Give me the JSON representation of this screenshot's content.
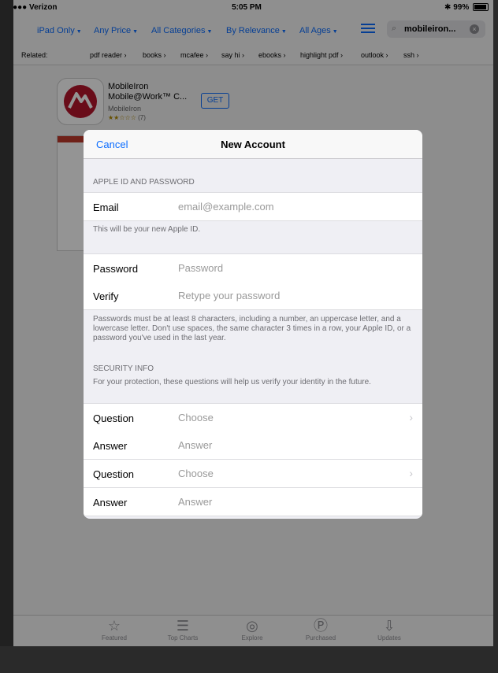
{
  "status": {
    "carrier": "●●●●● Verizon",
    "time": "5:05 PM",
    "battery": "99%"
  },
  "filters": {
    "device": "iPad Only",
    "price": "Any Price",
    "categories": "All Categories",
    "sort": "By Relevance",
    "ages": "All Ages"
  },
  "search": {
    "query": "mobileiron..."
  },
  "related": {
    "label": "Related:",
    "items": [
      "pdf reader",
      "books",
      "mcafee",
      "say hi",
      "ebooks",
      "highlight pdf",
      "outlook",
      "ssh"
    ]
  },
  "app": {
    "name_line1": "MobileIron",
    "name_line2": "Mobile@Work™ C...",
    "developer": "MobileIron",
    "stars": "★★☆☆☆",
    "rating_count": "(7)",
    "get_label": "GET"
  },
  "tabs": [
    {
      "label": "Featured",
      "icon": "star-icon"
    },
    {
      "label": "Top Charts",
      "icon": "list-icon"
    },
    {
      "label": "Explore",
      "icon": "compass-icon"
    },
    {
      "label": "Purchased",
      "icon": "purchased-icon"
    },
    {
      "label": "Updates",
      "icon": "download-icon"
    }
  ],
  "modal": {
    "cancel": "Cancel",
    "title": "New Account",
    "apple_id_header": "APPLE ID AND PASSWORD",
    "email_label": "Email",
    "email_placeholder": "email@example.com",
    "email_footer": "This will be your new Apple ID.",
    "password_label": "Password",
    "password_placeholder": "Password",
    "verify_label": "Verify",
    "verify_placeholder": "Retype your password",
    "password_footer": "Passwords must be at least 8 characters, including a number, an uppercase letter, and a lowercase letter. Don't use spaces, the same character 3 times in a row, your Apple ID, or a password you've used in the last year.",
    "security_header": "SECURITY INFO",
    "security_desc": "For your protection, these questions will help us verify your identity in the future.",
    "question1_label": "Question",
    "question1_value": "Choose",
    "answer1_label": "Answer",
    "answer1_placeholder": "Answer",
    "question2_label": "Question",
    "question2_value": "Choose",
    "answer2_label": "Answer",
    "answer2_placeholder": "Answer"
  },
  "colors": {
    "accent": "#0a6cff",
    "brand_red": "#b5152b"
  }
}
